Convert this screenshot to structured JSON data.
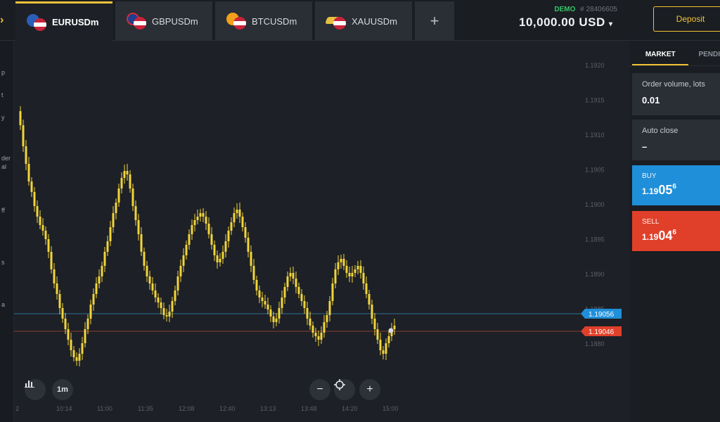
{
  "tabs": [
    {
      "label": "EURUSDm",
      "active": true,
      "flag_a": "#2a5fb8",
      "flag_b": "#ffffff"
    },
    {
      "label": "GBPUSDm",
      "active": false,
      "flag_a": "#1e3f8f",
      "flag_b": "#ffffff"
    },
    {
      "label": "BTCUSDm",
      "active": false,
      "flag_a": "#f29f1b",
      "flag_b": "#ffffff"
    },
    {
      "label": "XAUUSDm",
      "active": false,
      "flag_a": "#e8c040",
      "flag_b": "#ffffff"
    }
  ],
  "add_tab_label": "+",
  "account": {
    "type": "DEMO",
    "number": "# 28406605",
    "balance": "10,000.00 USD",
    "balance_caret": "▾"
  },
  "deposit_label": "Deposit",
  "left_strip_glyphs": [
    "p",
    "t",
    "y",
    "der",
    "al",
    "ff",
    "s",
    "a"
  ],
  "chart": {
    "price_axis": [
      "1.1920",
      "1.1915",
      "1.1910",
      "1.1905",
      "1.1900",
      "1.1895",
      "1.1890",
      "1.1885",
      "1.1880"
    ],
    "time_axis": [
      "2",
      "10:14",
      "11:00",
      "11:35",
      "12:08",
      "12:40",
      "13:13",
      "13:48",
      "14:20",
      "15:00"
    ],
    "buy_line_label": "1.19056",
    "sell_line_label": "1.19046",
    "buy_color": "#1f8fd9",
    "sell_color": "#e0402a",
    "candle_color": "#f1d53a",
    "timeframe": "1m",
    "zoom_out": "−",
    "zoom_in": "+"
  },
  "panel": {
    "tab_market": "MARKET",
    "tab_pending": "PENDI",
    "order_volume_label": "Order volume, lots",
    "order_volume_value": "0.01",
    "auto_close_label": "Auto close",
    "auto_close_value": "–",
    "buy": {
      "label": "BUY",
      "q1": "1.19",
      "q2": "05",
      "q3": "6"
    },
    "sell": {
      "label": "SELL",
      "q1": "1.19",
      "q2": "04",
      "q3": "6"
    }
  }
}
